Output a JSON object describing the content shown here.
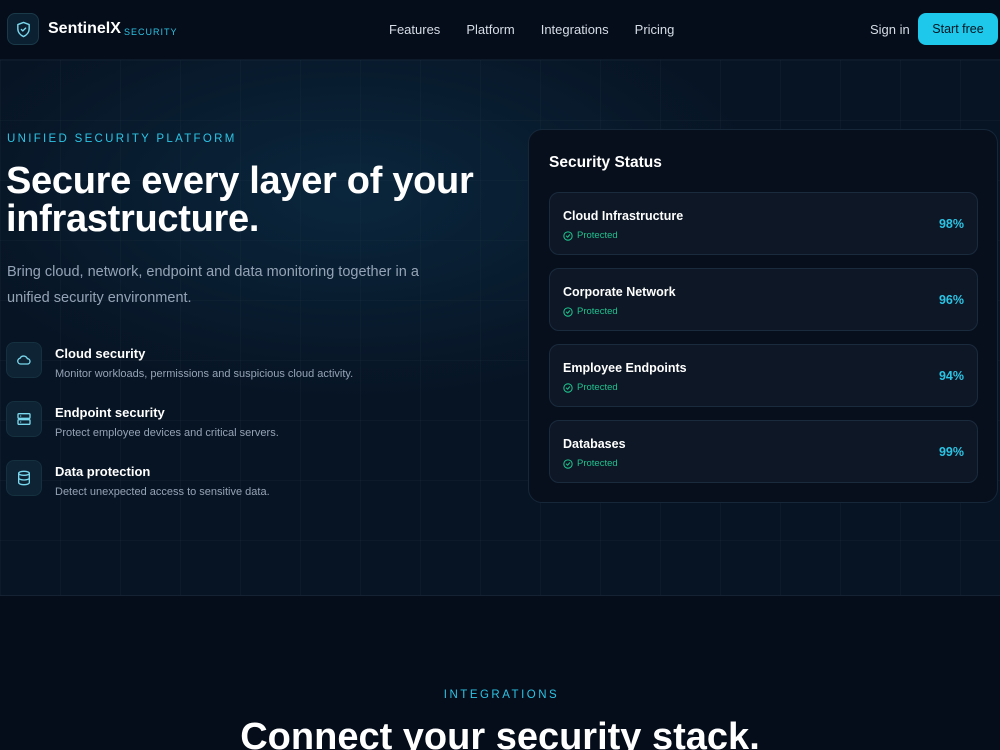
{
  "nav": {
    "brand": "SentinelX",
    "brand_sub": "SECURITY",
    "links": [
      "Features",
      "Platform",
      "Integrations",
      "Pricing"
    ],
    "signin": "Sign in",
    "cta": "Start free"
  },
  "hero": {
    "eyebrow": "UNIFIED SECURITY PLATFORM",
    "title": "Secure every layer of your infrastructure.",
    "subtitle": "Bring cloud, network, endpoint and data monitoring together in a unified security environment.",
    "features": [
      {
        "icon": "cloud-icon",
        "title": "Cloud security",
        "desc": "Monitor workloads, permissions and suspicious cloud activity."
      },
      {
        "icon": "server-icon",
        "title": "Endpoint security",
        "desc": "Protect employee devices and critical servers."
      },
      {
        "icon": "database-icon",
        "title": "Data protection",
        "desc": "Detect unexpected access to sensitive data."
      }
    ]
  },
  "status_panel": {
    "title": "Security Status",
    "items": [
      {
        "name": "Cloud Infrastructure",
        "status": "Protected",
        "value": "98%"
      },
      {
        "name": "Corporate Network",
        "status": "Protected",
        "value": "96%"
      },
      {
        "name": "Employee Endpoints",
        "status": "Protected",
        "value": "94%"
      },
      {
        "name": "Databases",
        "status": "Protected",
        "value": "99%"
      }
    ]
  },
  "integrations": {
    "eyebrow": "INTEGRATIONS",
    "title": "Connect your security stack."
  },
  "colors": {
    "accent": "#1ec8ea",
    "success": "#1fc18c",
    "background": "#050c1a"
  }
}
